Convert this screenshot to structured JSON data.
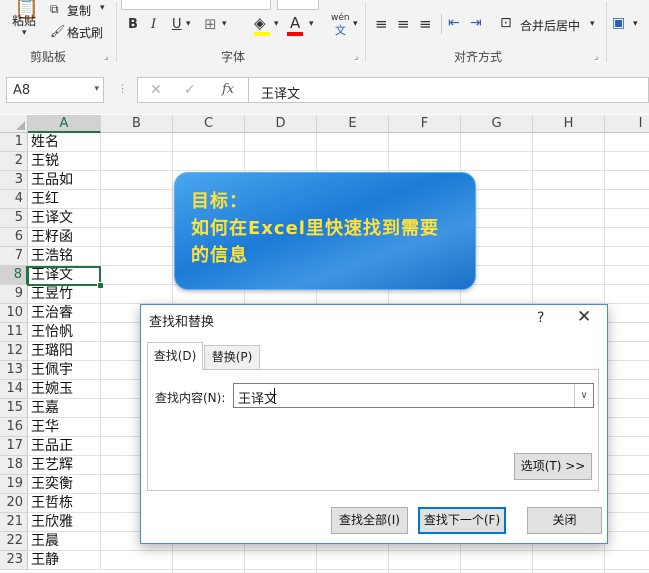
{
  "ribbon": {
    "clipboard": {
      "paste": "粘贴",
      "copy": "复制",
      "format_painter": "格式刷",
      "group": "剪贴板"
    },
    "font": {
      "bold": "B",
      "italic": "I",
      "underline": "U",
      "phonetic_top": "wén",
      "phonetic_bottom": "文",
      "group": "字体",
      "font_color": "#ff0000"
    },
    "alignment": {
      "merge": "合并后居中",
      "group": "对齐方式"
    }
  },
  "formula_bar": {
    "name_box": "A8",
    "fx": "fx",
    "cancel": "✕",
    "enter": "✓",
    "content": "王译文"
  },
  "columns": [
    "A",
    "B",
    "C",
    "D",
    "E",
    "F",
    "G",
    "H",
    "I"
  ],
  "rows": [
    {
      "n": "1",
      "a": "姓名"
    },
    {
      "n": "2",
      "a": "王锐"
    },
    {
      "n": "3",
      "a": "王品如"
    },
    {
      "n": "4",
      "a": "王红"
    },
    {
      "n": "5",
      "a": "王译文"
    },
    {
      "n": "6",
      "a": "王籽函"
    },
    {
      "n": "7",
      "a": "王浩铭"
    },
    {
      "n": "8",
      "a": "王译文"
    },
    {
      "n": "9",
      "a": "王昱竹"
    },
    {
      "n": "10",
      "a": "王治睿"
    },
    {
      "n": "11",
      "a": "王怡帆"
    },
    {
      "n": "12",
      "a": "王璐阳"
    },
    {
      "n": "13",
      "a": "王佩宇"
    },
    {
      "n": "14",
      "a": "王婉玉"
    },
    {
      "n": "15",
      "a": "王嘉"
    },
    {
      "n": "16",
      "a": "王华"
    },
    {
      "n": "17",
      "a": "王品正"
    },
    {
      "n": "18",
      "a": "王艺辉"
    },
    {
      "n": "19",
      "a": "王奕衡"
    },
    {
      "n": "20",
      "a": "王哲栋"
    },
    {
      "n": "21",
      "a": "王欣雅"
    },
    {
      "n": "22",
      "a": "王晨"
    },
    {
      "n": "23",
      "a": "王静"
    }
  ],
  "callout": {
    "line1": "目标：",
    "line2": "如何在Excel里快速找到需要",
    "line3": "的信息"
  },
  "dialog": {
    "title": "查找和替换",
    "help": "?",
    "close": "✕",
    "tab_find": "查找(D)",
    "tab_replace": "替换(P)",
    "find_label": "查找内容(N):",
    "find_value": "王译文",
    "options": "选项(T) >>",
    "find_all": "查找全部(I)",
    "find_next": "查找下一个(F)",
    "close_button": "关闭"
  }
}
